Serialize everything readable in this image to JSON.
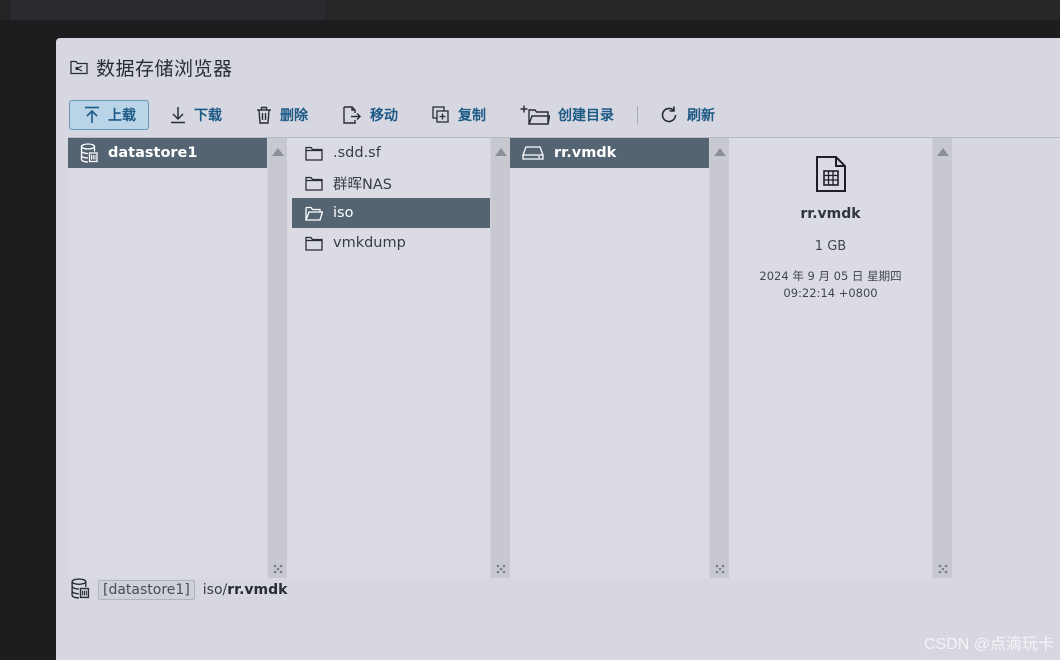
{
  "dialog": {
    "title": "数据存储浏览器",
    "title_icon": "datastore-folder-icon"
  },
  "toolbar": {
    "upload": "上载",
    "download": "下载",
    "delete": "删除",
    "move": "移动",
    "copy": "复制",
    "mkdir": "创建目录",
    "refresh": "刷新",
    "accent": "#1d5a86"
  },
  "columns": {
    "datastores": [
      {
        "label": "datastore1",
        "selected": true,
        "icon": "datastore-icon"
      }
    ],
    "folders": [
      {
        "label": ".sdd.sf",
        "selected": false,
        "icon": "folder-icon"
      },
      {
        "label": "群晖NAS",
        "selected": false,
        "icon": "folder-icon"
      },
      {
        "label": "iso",
        "selected": true,
        "icon": "folder-open-icon"
      },
      {
        "label": "vmkdump",
        "selected": false,
        "icon": "folder-icon"
      }
    ],
    "files": [
      {
        "label": "rr.vmdk",
        "selected": true,
        "icon": "disk-icon"
      }
    ]
  },
  "preview": {
    "name": "rr.vmdk",
    "size": "1 GB",
    "date_line1": "2024 年 9 月 05 日 星期四",
    "date_line2": "09:22:14 +0800",
    "icon": "vmdk-file-icon"
  },
  "status": {
    "datastore_tag": "[datastore1]",
    "path_prefix": "iso/",
    "path_file": "rr.vmdk"
  },
  "watermark": "CSDN @点滴玩卡",
  "colors": {
    "selection": "#546472",
    "dialog_bg": "#d6d7e0",
    "button_active": "#b9d4e6"
  }
}
